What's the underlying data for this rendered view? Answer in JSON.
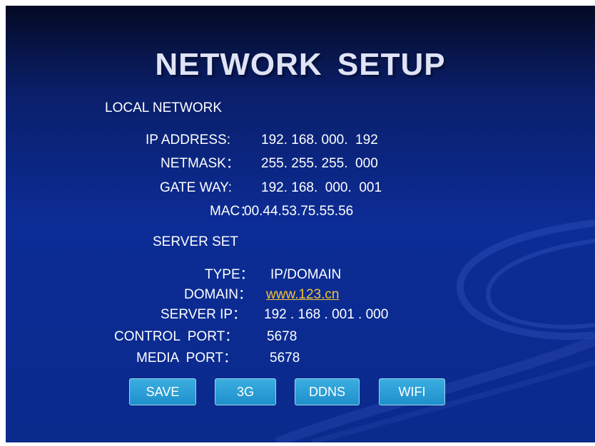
{
  "title": "NETWORK  SETUP",
  "local_network": {
    "heading": "LOCAL NETWORK",
    "ip_address_label": "IP ADDRESS:",
    "ip_address_value": "192. 168. 000.  192",
    "netmask_label": "NETMASK：",
    "netmask_value": "255. 255. 255.  000",
    "gateway_label": "GATE WAY:",
    "gateway_value": "192. 168.  000.  001",
    "mac_label": "MAC：",
    "mac_value": "00.44.53.75.55.56"
  },
  "server_set": {
    "heading": "SERVER SET",
    "type_label": "TYPE：",
    "type_value": "IP/DOMAIN",
    "domain_label": "DOMAIN：",
    "domain_value": "www.123.cn",
    "server_ip_label": "SERVER IP：",
    "server_ip_value": "192 . 168 . 001 . 000",
    "control_port_label": "CONTROL  PORT：",
    "control_port_value": "5678",
    "media_port_label": "MEDIA  PORT：",
    "media_port_value": "5678"
  },
  "buttons": {
    "save": "SAVE",
    "g3": "3G",
    "ddns": "DDNS",
    "wifi": "WIFI"
  },
  "colors": {
    "background_top": "#040a24",
    "background_main": "#0c2c96",
    "link": "#f4c431",
    "button": "#2a9fd8"
  }
}
